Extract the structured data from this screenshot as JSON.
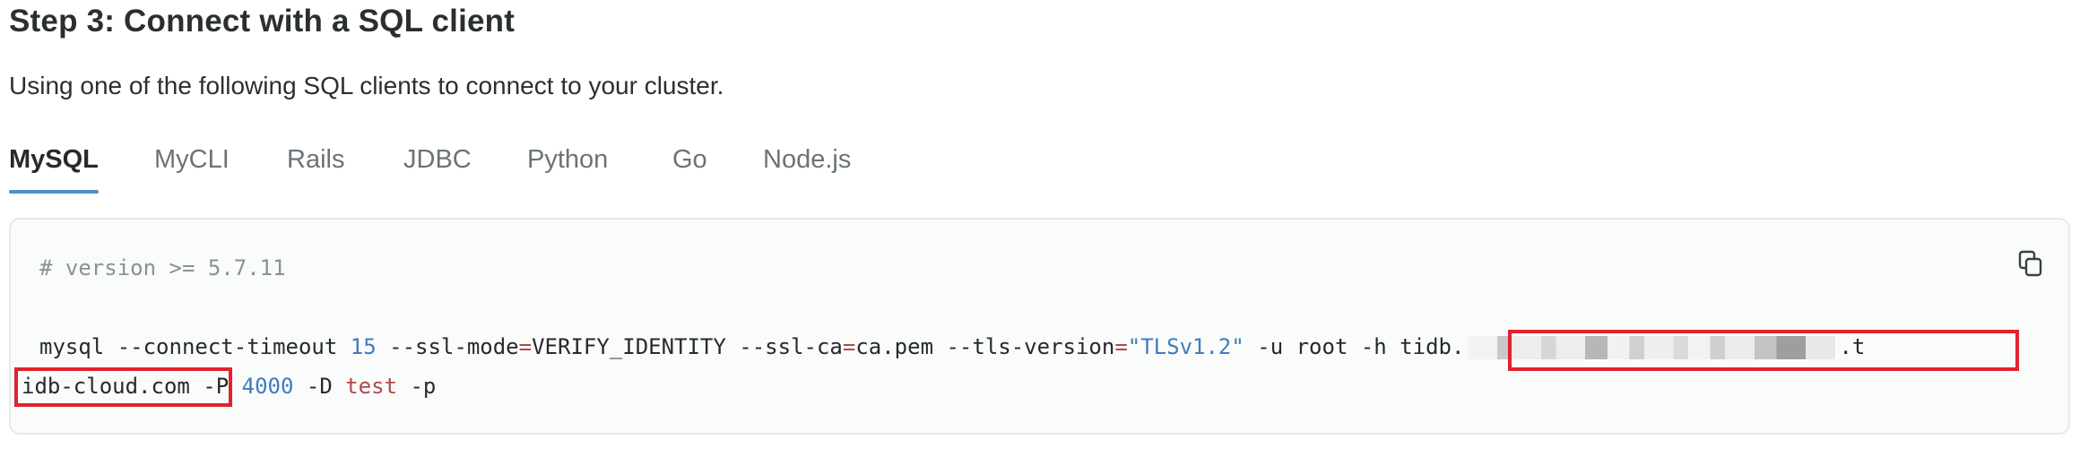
{
  "heading": "Step 3: Connect with a SQL client",
  "subtitle": "Using one of the following SQL clients to connect to your cluster.",
  "tabs": [
    {
      "label": "MySQL",
      "active": true
    },
    {
      "label": "MyCLI",
      "active": false
    },
    {
      "label": "Rails",
      "active": false
    },
    {
      "label": "JDBC",
      "active": false
    },
    {
      "label": "Python",
      "active": false
    },
    {
      "label": "Go",
      "active": false
    },
    {
      "label": "Node.js",
      "active": false
    }
  ],
  "code": {
    "comment": "# version >= 5.7.11",
    "line1": {
      "cmd": "mysql --connect-timeout ",
      "timeout": "15",
      "ssl_mode_flag": " --ssl-mode",
      "eq1": "=",
      "ssl_mode_value": "VERIFY_IDENTITY --ssl-ca",
      "eq2": "=",
      "ssl_ca_value": "ca.pem --tls-version",
      "eq3": "=",
      "tls_version": "\"TLSv1.2\"",
      "user_flags": " -u root -h ",
      "host_prefix": "tidb.",
      "host_suffix_end": ".t"
    },
    "line2": {
      "host_suffix": "idb-cloud.com",
      "port_flag": " -P ",
      "port": "4000",
      "db_flag": " -D ",
      "db": "test",
      "pass_flag": " -p"
    }
  },
  "icons": {
    "copy": "copy-icon"
  },
  "colors": {
    "tab_underline": "#4f8fc4",
    "highlight_border": "#e0232e",
    "number": "#3f7cbf",
    "keyword_red": "#b04a4a"
  }
}
